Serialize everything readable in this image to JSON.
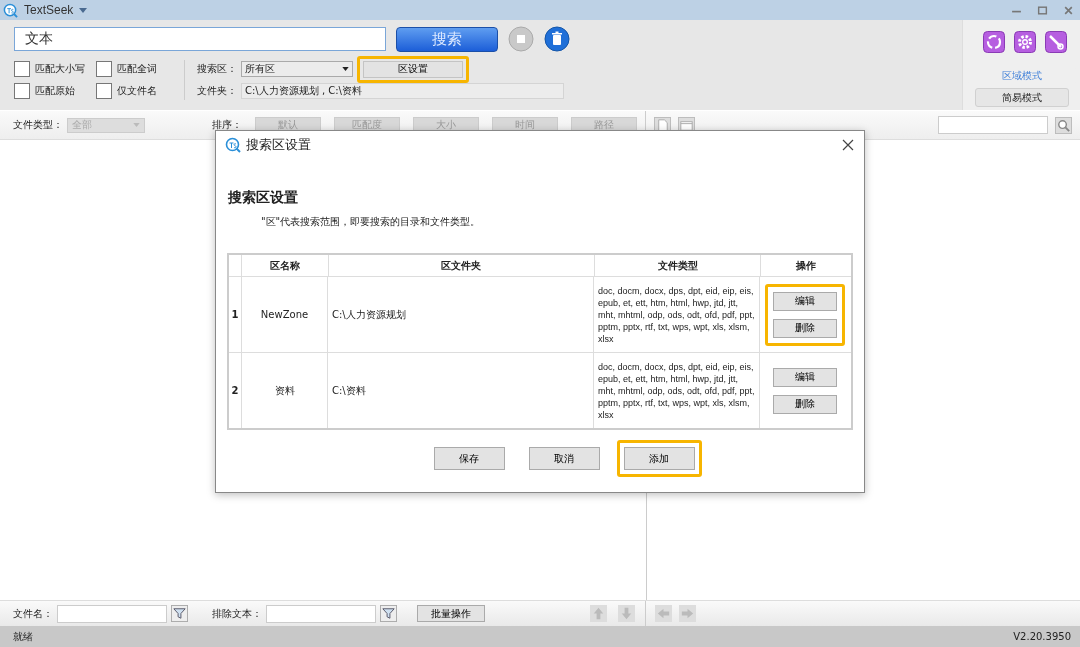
{
  "window": {
    "title": "TextSeek"
  },
  "search": {
    "value": "文本",
    "button": "搜索"
  },
  "options": [
    {
      "label": "匹配大小写",
      "checked": false
    },
    {
      "label": "匹配全词",
      "checked": false
    },
    {
      "label": "匹配原始",
      "checked": false
    },
    {
      "label": "仅文件名",
      "checked": false
    }
  ],
  "zone": {
    "label": "搜索区：",
    "value": "所有区",
    "settings_button": "区设置",
    "settings_highlighted": true,
    "folder_label": "文件夹：",
    "folder_value": "C:\\人力资源规划 , C:\\资料"
  },
  "modes": [
    {
      "label": "区域模式",
      "selected": true
    },
    {
      "label": "简易模式",
      "selected": false
    }
  ],
  "filter": {
    "type_label": "文件类型：",
    "type_value": "全部",
    "sort_label": "排序：",
    "sort_buttons": [
      "默认",
      "匹配度",
      "大小",
      "时间",
      "路径"
    ]
  },
  "bottom": {
    "filename_label": "文件名：",
    "exclude_label": "排除文本：",
    "batch_button": "批量操作"
  },
  "status_bar": {
    "left": "就绪",
    "right": "V2.20.3950"
  },
  "dialog": {
    "title": "搜索区设置",
    "heading": "搜索区设置",
    "description": "\"区\"代表搜索范围，即要搜索的目录和文件类型。",
    "columns": [
      "区名称",
      "区文件夹",
      "文件类型",
      "操作"
    ],
    "rows": [
      {
        "index": "1",
        "name": "NewZone",
        "folder": "C:\\人力资源规划",
        "types": "doc, docm, docx, dps, dpt, eid, eip, eis, epub, et, ett, htm, html, hwp, jtd, jtt, mht, mhtml, odp, ods, odt, ofd, pdf, ppt, pptm, pptx, rtf, txt, wps, wpt, xls, xlsm, xlsx",
        "actions": [
          "编辑",
          "删除"
        ],
        "highlighted": true
      },
      {
        "index": "2",
        "name": "资料",
        "folder": "C:\\资料",
        "types": "doc, docm, docx, dps, dpt, eid, eip, eis, epub, et, ett, htm, html, hwp, jtd, jtt, mht, mhtml, odp, ods, odt, ofd, pdf, ppt, pptm, pptx, rtf, txt, wps, wpt, xls, xlsm, xlsx",
        "actions": [
          "编辑",
          "删除"
        ],
        "highlighted": false
      }
    ],
    "buttons": [
      {
        "label": "保存",
        "highlighted": false
      },
      {
        "label": "取消",
        "highlighted": false
      },
      {
        "label": "添加",
        "highlighted": true
      }
    ]
  }
}
